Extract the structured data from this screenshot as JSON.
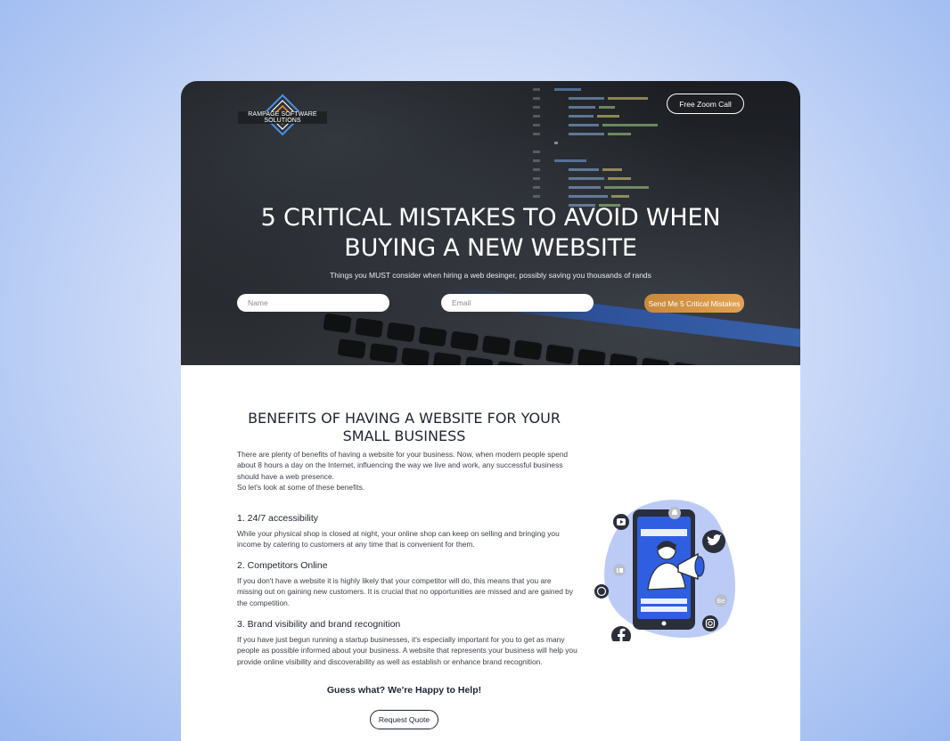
{
  "header": {
    "logo_text": "RAMPAGE SOFTWARE SOLUTIONS",
    "zoom_button": "Free Zoom Call"
  },
  "hero": {
    "title_line1": "5 CRITICAL MISTAKES TO AVOID WHEN",
    "title_line2": "BUYING A NEW WEBSITE",
    "subtitle": "Things you MUST consider when hiring a web desinger, possibly saving you thousands of rands",
    "name_placeholder": "Name",
    "email_placeholder": "Email",
    "submit_label": "Send Me 5 Critical Mistakes"
  },
  "benefits": {
    "title_line1": "BENEFITS OF HAVING A WEBSITE FOR YOUR",
    "title_line2": "SMALL BUSINESS",
    "intro_line1": "There are plenty of benefits of having a website for your business. Now, when modern people spend",
    "intro_line2": "about 8 hours a day on the Internet, influencing the way we live and work, any successful business",
    "intro_line3": "should have a web presence.",
    "intro_line4": "So let's look at some of these benefits.",
    "items": [
      {
        "heading": "1. 24/7 accessibility",
        "line1": "While your physical shop is closed at night, your online shop can keep on selling and bringing you",
        "line2": "income by catering to customers at any time that is convenient for them."
      },
      {
        "heading": "2. Competitors Online",
        "line1": "If you don't have a website it is highly likely that your competitor will do, this means that you are",
        "line2": "missing out on gaining new customers. It is crucial that no opportunities are missed and are gained by",
        "line3": "the competition."
      },
      {
        "heading": "3. Brand visibility and brand recognition",
        "line1": "If you have just begun running a startup businesses, it's especially important for you to get as many",
        "line2": "people as possible informed about your business. A website that represents your business will help you",
        "line3": "provide online visibility and discoverability as well as establish or enhance brand recognition."
      }
    ]
  },
  "cta": {
    "title": "Guess what? We're Happy to Help!",
    "button": "Request Quote"
  },
  "colors": {
    "accent_orange": "#e3a253",
    "text_dark": "#1f2430",
    "illustration_blue": "#2f5fe0",
    "illustration_bg": "#bccbf6"
  }
}
